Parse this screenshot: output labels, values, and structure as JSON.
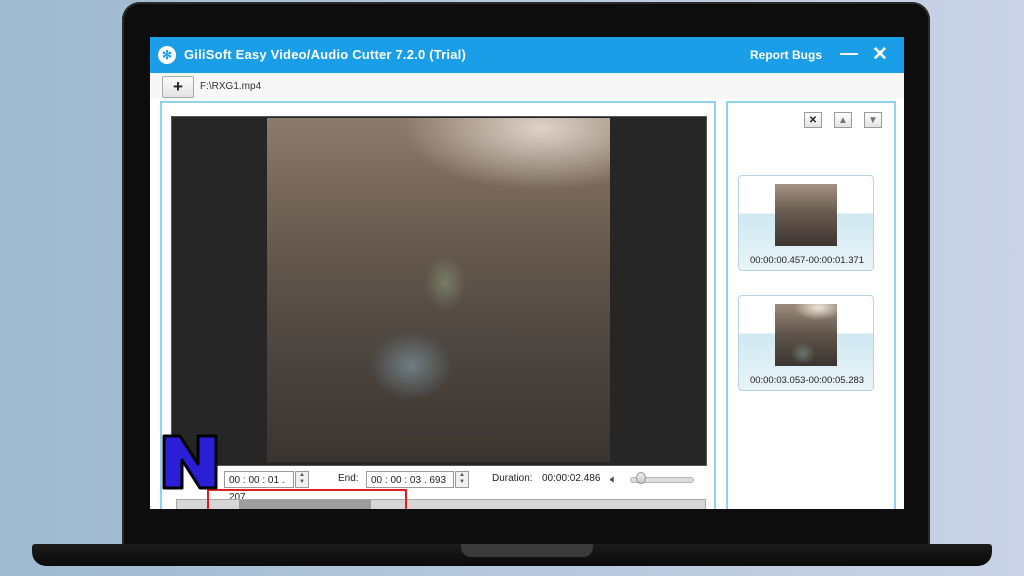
{
  "app": {
    "icon": "film-reel-icon",
    "title": "GiliSoft Easy Video/Audio Cutter 7.2.0 (Trial)",
    "report_bugs": "Report Bugs",
    "minimize": "—",
    "close": "✕"
  },
  "toolbar": {
    "add_label": "+",
    "file_path": "F:\\RXG1.mp4"
  },
  "controls": {
    "start_value": "00 : 00 : 01 . 207",
    "end_label": "End:",
    "end_value": "00 : 00 : 03 . 693",
    "duration_label": "Duration:",
    "duration_value": "00:00:02.486",
    "volume_icon": "speaker-icon"
  },
  "clip_list": {
    "delete_icon": "✕",
    "up_icon": "▲",
    "down_icon": "▼",
    "clips": [
      {
        "time": "00:00:00.457-00:00:01.371"
      },
      {
        "time": "00:00:03.053-00:00:05.283"
      }
    ]
  },
  "overlay": {
    "logo_letter": "N"
  },
  "colors": {
    "titlebar": "#1a9ee8",
    "panel_border": "#8fd0f4",
    "highlight": "#e02020",
    "logo_fill": "#2b1fd6",
    "logo_outline": "#000000"
  }
}
